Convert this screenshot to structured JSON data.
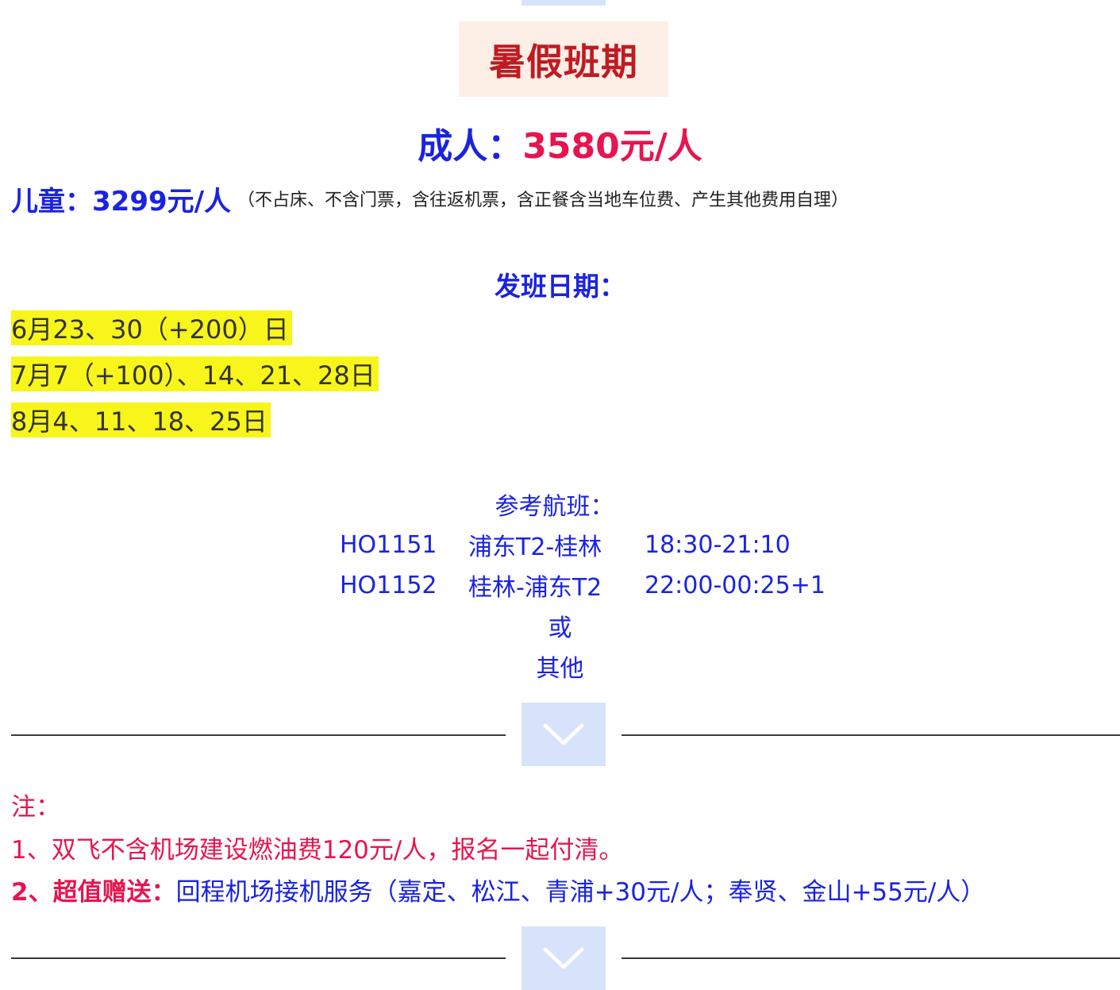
{
  "title": "暑假班期",
  "adult": {
    "label": "成人：",
    "price": "3580元/人"
  },
  "child": {
    "label": "儿童：3299元/人",
    "note": "（不占床、不含门票，含往返机票，含正餐含当地车位费、产生其他费用自理）"
  },
  "dates": {
    "heading": "发班日期：",
    "rows": [
      "6月23、30（+200）日",
      "7月7（+100）、14、21、28日",
      "8月4、11、18、25日"
    ]
  },
  "flights": {
    "heading": "参考航班：",
    "rows": [
      {
        "code": "HO1151",
        "route": "浦东T2-桂林",
        "time": "18:30-21:10"
      },
      {
        "code": "HO1152",
        "route": "桂林-浦东T2",
        "time": "22:00-00:25+1"
      }
    ],
    "or": "或",
    "other": "其他"
  },
  "notes": {
    "heading": "注：",
    "item1": "1、双飞不含机场建设燃油费120元/人，报名一起付清。",
    "item2_label": "2、超值赠送：",
    "item2_text": "回程机场接机服务（嘉定、松江、青浦+30元/人；奉贤、金山+55元/人）"
  },
  "icons": {
    "divider": "chevron-down-icon"
  },
  "colors": {
    "title_red": "#c01a22",
    "price_red": "#e6154f",
    "blue": "#1a23e0",
    "highlight": "#f7f51a",
    "title_bg": "#fdeee6",
    "chevron_bg": "#d6e3fb"
  }
}
